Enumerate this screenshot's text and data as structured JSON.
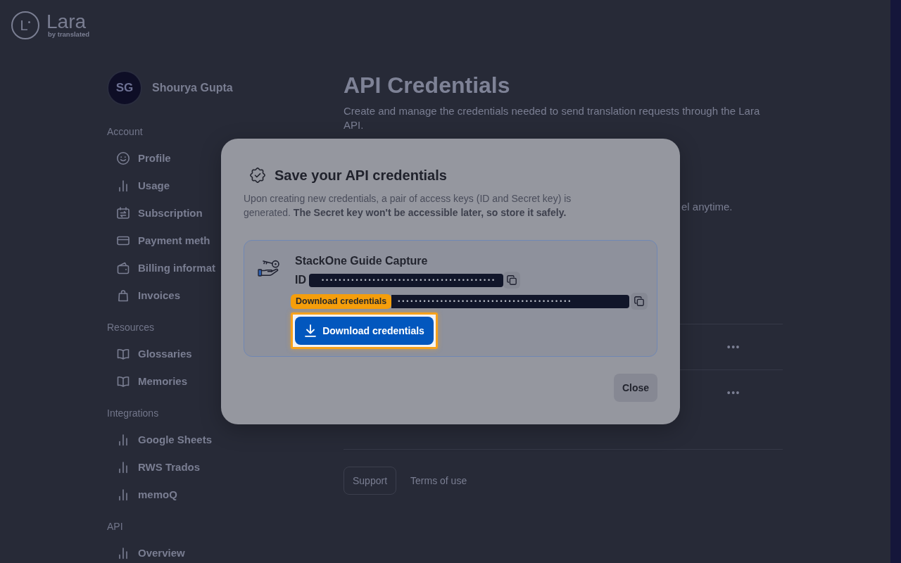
{
  "logo": {
    "mark": "L",
    "name": "Lara",
    "tagline": "by translated"
  },
  "user": {
    "initials": "SG",
    "name": "Shourya Gupta"
  },
  "sidebar": {
    "sections": [
      {
        "title": "Account",
        "items": [
          {
            "label": "Profile"
          },
          {
            "label": "Usage"
          },
          {
            "label": "Subscription"
          },
          {
            "label": "Payment meth"
          },
          {
            "label": "Billing informat"
          },
          {
            "label": "Invoices"
          }
        ]
      },
      {
        "title": "Resources",
        "items": [
          {
            "label": "Glossaries"
          },
          {
            "label": "Memories"
          }
        ]
      },
      {
        "title": "Integrations",
        "items": [
          {
            "label": "Google Sheets"
          },
          {
            "label": "RWS Trados"
          },
          {
            "label": "memoQ"
          }
        ]
      },
      {
        "title": "API",
        "items": [
          {
            "label": "Overview"
          }
        ]
      }
    ]
  },
  "main": {
    "title": "API Credentials",
    "description": "Create and manage the credentials needed to send translation requests through the Lara API.",
    "paragraph_fragment": "el anytime.",
    "credential_rows": [
      {
        "menu": "•••"
      },
      {
        "menu": "•••"
      }
    ],
    "footer_links": [
      {
        "label": "Support",
        "kind": "button"
      },
      {
        "label": "Terms of use",
        "kind": "link"
      }
    ]
  },
  "dialog": {
    "title": "Save your API credentials",
    "description": "Upon creating new credentials, a pair of access keys (ID and Secret key) is generated. **The Secret key won't be accessible later, so store it safely.**",
    "credential": {
      "name": "StackOne Guide Capture",
      "id_label": "ID",
      "id_value": "•••••••••••••••••••••••••••••••••••••••••",
      "secret_value": "•••••••••••••••••••••••••••••••••••••••••"
    },
    "guide_tooltip": "Download credentials",
    "download_button": {
      "label": "Download credentials",
      "highlighted": true
    },
    "close_button": "Close"
  }
}
